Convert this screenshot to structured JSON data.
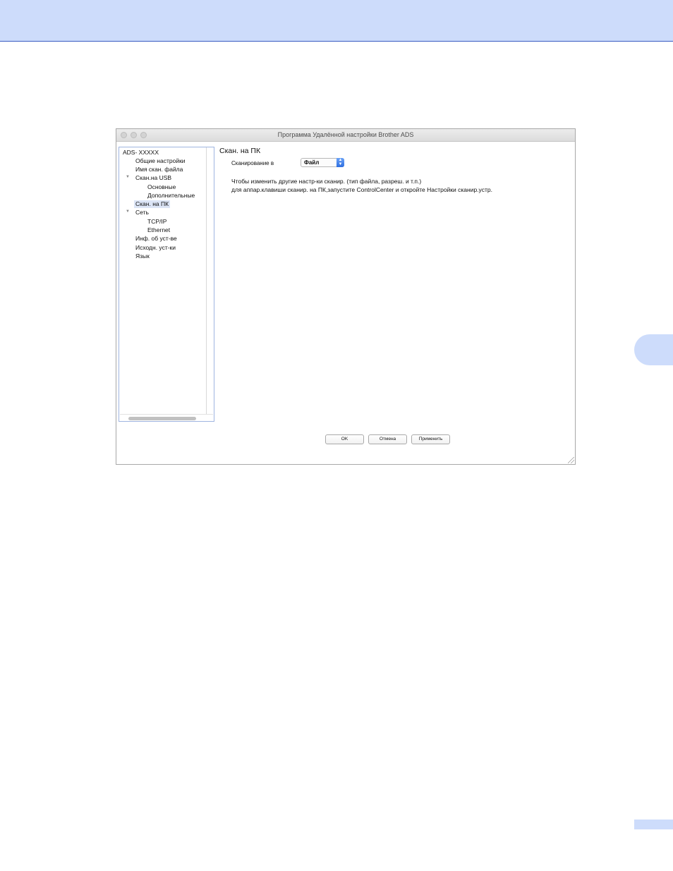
{
  "window": {
    "title": "Программа Удалённой настройки Brother ADS"
  },
  "sidebar": {
    "items": [
      {
        "label": "ADS- XXXXX",
        "level": 0
      },
      {
        "label": "Общие настройки",
        "level": 1
      },
      {
        "label": "Имя скан. файла",
        "level": 1
      },
      {
        "label": "Скан.на USB",
        "level": 1,
        "expanded": true
      },
      {
        "label": "Основные",
        "level": 2
      },
      {
        "label": "Дополнительные",
        "level": 2
      },
      {
        "label": "Скан. на ПК",
        "level": 1,
        "selected": true
      },
      {
        "label": "Сеть",
        "level": 1,
        "expanded": true
      },
      {
        "label": "TCP/IP",
        "level": 2
      },
      {
        "label": "Ethernet",
        "level": 2
      },
      {
        "label": "Инф. об уст-ве",
        "level": 1
      },
      {
        "label": "Исходн. уст-ки",
        "level": 1
      },
      {
        "label": "Язык",
        "level": 1
      }
    ]
  },
  "content": {
    "title": "Скан. на ПК",
    "scan_to_label": "Сканирование в",
    "scan_to_value": "Файл",
    "info_line_1": "Чтобы изменить другие настр-ки сканир. (тип файла, разреш. и т.п.)",
    "info_line_2": "для аппар.клавиши сканир. на ПК,запустите ControlCenter и откройте Настройки сканир.устр."
  },
  "buttons": {
    "ok": "OK",
    "cancel": "Отмена",
    "apply": "Применить"
  },
  "colors": {
    "header_band": "#cddcfb",
    "header_rule": "#3a5bc2",
    "selection": "#dce5f6",
    "stepper_blue": "#2f6fe0"
  }
}
